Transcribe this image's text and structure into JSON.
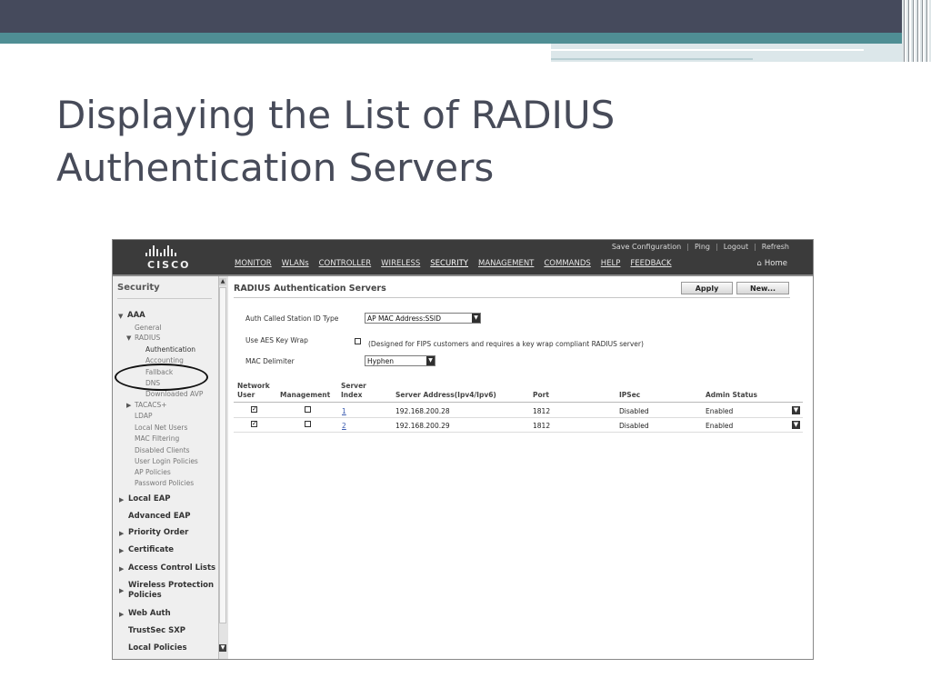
{
  "slide": {
    "title_line1": "Displaying the List of RADIUS",
    "title_line2": "Authentication Servers"
  },
  "colors": {
    "slide_top_bar": "#454a5c",
    "slide_teal": "#4f8e94",
    "title_text": "#474b59",
    "header_bg": "#3b3b3b",
    "sidebar_bg": "#efefef"
  },
  "header": {
    "logo_text": "CISCO",
    "utility_links": [
      "Save Configuration",
      "Ping",
      "Logout",
      "Refresh"
    ],
    "nav": [
      "MONITOR",
      "WLANs",
      "CONTROLLER",
      "WIRELESS",
      "SECURITY",
      "MANAGEMENT",
      "COMMANDS",
      "HELP",
      "FEEDBACK"
    ],
    "active_nav": "SECURITY",
    "home_label": "Home",
    "home_icon": "home-icon"
  },
  "sidebar": {
    "title": "Security",
    "aaa": "AAA",
    "general": "General",
    "radius": "RADIUS",
    "authentication": "Authentication",
    "accounting": "Accounting",
    "fallback": "Fallback",
    "dns": "DNS",
    "downloaded_avp": "Downloaded AVP",
    "tacacs": "TACACS+",
    "ldap": "LDAP",
    "local_net_users": "Local Net Users",
    "mac_filtering": "MAC Filtering",
    "disabled_clients": "Disabled Clients",
    "user_login_policies": "User Login Policies",
    "ap_policies": "AP Policies",
    "password_policies": "Password Policies",
    "local_eap": "Local EAP",
    "advanced_eap": "Advanced EAP",
    "priority_order": "Priority Order",
    "certificate": "Certificate",
    "access_control_lists": "Access Control Lists",
    "wireless_protection_line1": "Wireless Protection",
    "wireless_protection_line2": "Policies",
    "web_auth": "Web Auth",
    "trustsec_sxp": "TrustSec SXP",
    "local_policies": "Local Policies"
  },
  "content": {
    "title": "RADIUS Authentication Servers",
    "apply_label": "Apply",
    "new_label": "New...",
    "auth_called_station_label": "Auth Called Station ID Type",
    "auth_called_station_value": "AP MAC Address:SSID",
    "aes_key_wrap_label": "Use AES Key Wrap",
    "aes_key_wrap_checked": false,
    "aes_key_wrap_note": "(Designed for FIPS customers and requires a key wrap compliant RADIUS server)",
    "mac_delimiter_label": "MAC Delimiter",
    "mac_delimiter_value": "Hyphen"
  },
  "table": {
    "headers": {
      "network_user_line1": "Network",
      "network_user_line2": "User",
      "management": "Management",
      "server_index_line1": "Server",
      "server_index_line2": "Index",
      "server_address": "Server Address(Ipv4/Ipv6)",
      "port": "Port",
      "ipsec": "IPSec",
      "admin_status": "Admin Status"
    },
    "rows": [
      {
        "network_user": true,
        "management": false,
        "index": "1",
        "address": "192.168.200.28",
        "port": "1812",
        "ipsec": "Disabled",
        "admin_status": "Enabled"
      },
      {
        "network_user": true,
        "management": false,
        "index": "2",
        "address": "192.168.200.29",
        "port": "1812",
        "ipsec": "Disabled",
        "admin_status": "Enabled"
      }
    ]
  }
}
